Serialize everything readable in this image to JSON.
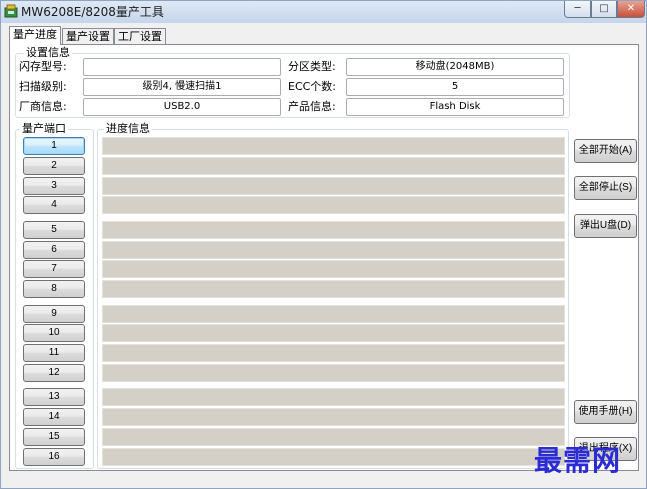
{
  "window": {
    "title": "MW6208E/8208量产工具",
    "minimize_glyph": "─",
    "maximize_glyph": "□",
    "close_glyph": "✕"
  },
  "tabs": [
    {
      "label": "量产进度",
      "active": true
    },
    {
      "label": "量产设置",
      "active": false
    },
    {
      "label": "工厂设置",
      "active": false
    }
  ],
  "settings": {
    "group_title": "设置信息",
    "flash_model_label": "闪存型号:",
    "flash_model_value": "",
    "scan_level_label": "扫描级别:",
    "scan_level_value": "级别4, 慢速扫描1",
    "vendor_label": "厂商信息:",
    "vendor_value": "USB2.0",
    "partition_label": "分区类型:",
    "partition_value": "移动盘(2048MB)",
    "ecc_label": "ECC个数:",
    "ecc_value": "5",
    "product_label": "产品信息:",
    "product_value": "Flash Disk"
  },
  "ports": {
    "group_title": "量产端口",
    "labels": [
      "1",
      "2",
      "3",
      "4",
      "5",
      "6",
      "7",
      "8",
      "9",
      "10",
      "11",
      "12",
      "13",
      "14",
      "15",
      "16"
    ]
  },
  "progress": {
    "group_title": "进度信息",
    "rows": [
      "",
      "",
      "",
      "",
      "",
      "",
      "",
      "",
      "",
      "",
      "",
      "",
      "",
      "",
      "",
      ""
    ]
  },
  "actions": {
    "start_all": "全部开始(A)",
    "stop_all": "全部停止(S)",
    "eject": "弹出U盘(D)",
    "manual": "使用手册(H)",
    "exit": "退出程序(X)"
  },
  "watermark": "最需网",
  "colors": {
    "progress_empty": "#d4d0c8",
    "watermark": "#2b2bd6"
  }
}
